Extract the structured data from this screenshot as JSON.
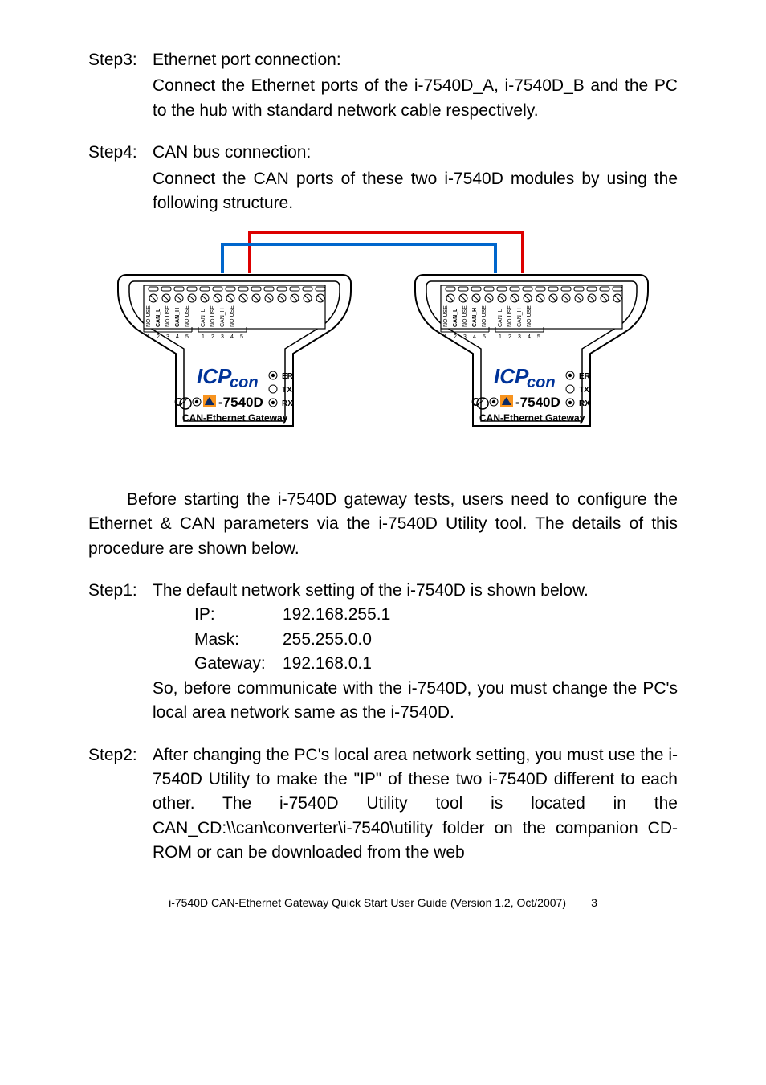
{
  "step3": {
    "label": "Step3:",
    "title": "Ethernet port connection:",
    "body": "Connect the Ethernet ports of the i-7540D_A, i-7540D_B and the PC to the hub with standard network cable respectively."
  },
  "step4": {
    "label": "Step4:",
    "title": "CAN bus connection:",
    "body": "Connect the CAN ports of these two i-7540D modules by using the following structure."
  },
  "para": "Before starting the i-7540D gateway tests, users need to configure the Ethernet & CAN parameters via the i-7540D Utility tool. The details of this procedure are shown below.",
  "step1": {
    "label": "Step1:",
    "title": "The default network setting of the i-7540D is shown below.",
    "ip_k": "IP:",
    "ip_v": "192.168.255.1",
    "mask_k": "Mask:",
    "mask_v": "255.255.0.0",
    "gw_k": "Gateway:",
    "gw_v": "192.168.0.1",
    "tail": "So, before communicate with the i-7540D, you must change the PC's local area network same as the i-7540D."
  },
  "step2": {
    "label": "Step2:",
    "body": "After changing the PC's local area network setting, you must use the i-7540D Utility to make the \"IP\" of these two i-7540D different to each other. The i-7540D Utility tool is located in the CAN_CD:\\\\can\\converter\\i-7540\\utility folder on the companion CD-ROM or can be downloaded from the web"
  },
  "footer": {
    "left": "i-7540D CAN-Ethernet Gateway Quick Start User Guide (Version 1.2, Oct/2007)",
    "page": "3"
  },
  "device": {
    "brand": "ICP",
    "brandSuffix": "con",
    "model": "-7540D",
    "gateway": "CAN-Ethernet Gateway",
    "leds": {
      "er": "ER",
      "tx": "TX",
      "rx": "RX"
    },
    "pins": [
      "NO USE",
      "CAN_L",
      "NO USE",
      "CAN_H",
      "NO USE",
      "CAN_L",
      "NO USE",
      "CAN_H",
      "NO USE"
    ],
    "nums": [
      "1",
      "2",
      "3",
      "4",
      "5",
      "1",
      "2",
      "3",
      "4",
      "5"
    ]
  }
}
